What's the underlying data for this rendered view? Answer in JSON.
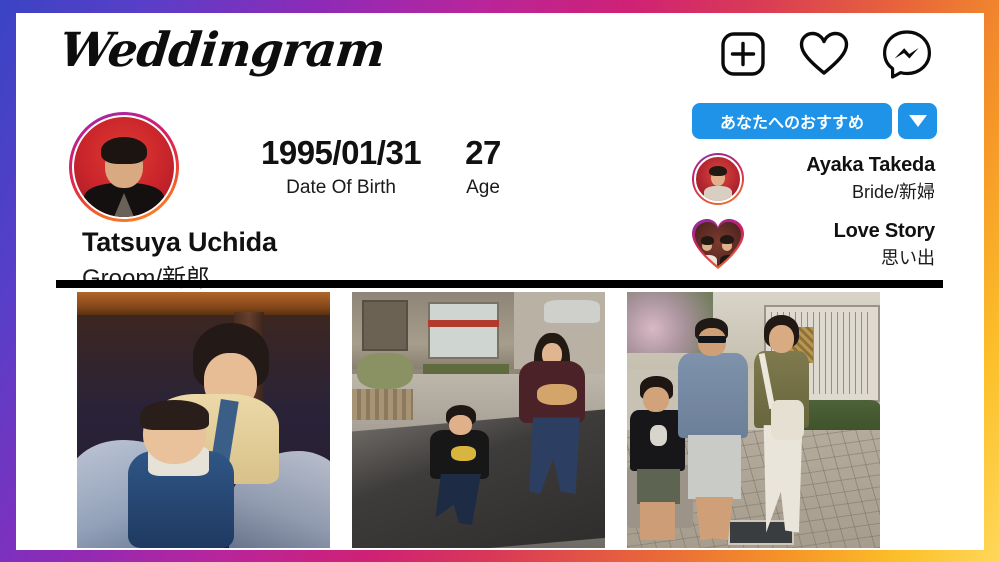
{
  "header": {
    "brand": "Weddingram",
    "icons": [
      {
        "name": "add-post-icon",
        "label": "New post"
      },
      {
        "name": "heart-icon",
        "label": "Activity"
      },
      {
        "name": "messenger-icon",
        "label": "Messages"
      }
    ]
  },
  "profile": {
    "name": "Tatsuya Uchida",
    "role": "Groom/新郎",
    "avatar_alt": "Tatsuya Uchida portrait",
    "stats": [
      {
        "value": "1995/01/31",
        "label": "Date Of Birth"
      },
      {
        "value": "27",
        "label": "Age"
      }
    ]
  },
  "suggestions": {
    "button_label": "あなたへのおすすめ",
    "dropdown_label": "▼",
    "items": [
      {
        "title": "Ayaka Takeda",
        "subtitle": "Bride/新婦",
        "thumb": "circle"
      },
      {
        "title": "Love Story",
        "subtitle": "思い出",
        "thumb": "heart"
      }
    ]
  },
  "gallery": {
    "photos": [
      {
        "name": "photo-child-with-baby",
        "alt": "Child holding a smiling baby indoors"
      },
      {
        "name": "photo-toddler-running",
        "alt": "Toddler running down a street with a woman"
      },
      {
        "name": "photo-family-plaza",
        "alt": "Family of three standing on a brick plaza"
      }
    ]
  },
  "colors": {
    "accent_blue": "#1f93e8",
    "divider_black": "#000000",
    "frame_gradient_start": "#3a44c4",
    "frame_gradient_mid": "#cf2175",
    "frame_gradient_end": "#fed85a",
    "card_background": "#ffffff"
  }
}
